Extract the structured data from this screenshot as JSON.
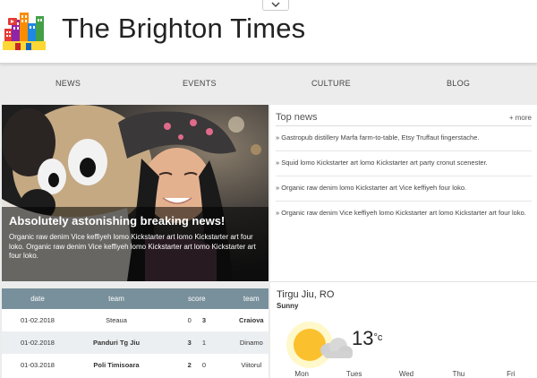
{
  "header": {
    "title": "The Brighton Times"
  },
  "nav": {
    "items": [
      "NEWS",
      "EVENTS",
      "CULTURE",
      "BLOG"
    ]
  },
  "hero": {
    "headline": "Absolutely astonishing breaking news!",
    "text": "Organic raw denim Vice keffiyeh lomo Kickstarter art lomo Kickstarter art four loko. Organic raw denim Vice keffiyeh lomo Kickstarter art lomo Kickstarter art four loko."
  },
  "top_news": {
    "title": "Top news",
    "more": "+ more",
    "items": [
      "» Gastropub distillery Marfa farm-to-table, Etsy Truffaut fingerstache.",
      "» Squid lomo Kickstarter art lomo Kickstarter art party cronut scenester.",
      "» Organic raw denim lomo Kickstarter art Vice keffiyeh four loko.",
      "» Organic raw denim Vice keffiyeh lomo Kickstarter art lomo Kickstarter art four loko."
    ]
  },
  "scores": {
    "headers": [
      "date",
      "team",
      "score",
      "team"
    ],
    "rows": [
      {
        "date": "01-02.2018",
        "team1": "Steaua",
        "s1": "0",
        "s2": "3",
        "team2": "Craiova",
        "winner": 2
      },
      {
        "date": "01-02.2018",
        "team1": "Panduri Tg Jiu",
        "s1": "3",
        "s2": "1",
        "team2": "Dinamo",
        "winner": 1
      },
      {
        "date": "01-03.2018",
        "team1": "Poli Timisoara",
        "s1": "2",
        "s2": "0",
        "team2": "Viitorul",
        "winner": 1
      }
    ]
  },
  "weather": {
    "city": "Tirgu Jiu, RO",
    "condition": "Sunny",
    "temp": "13",
    "unit": "°c",
    "days": [
      "Mon",
      "Tues",
      "Wed",
      "Thu",
      "Fri"
    ]
  },
  "colors": {
    "table_header": "#78909c",
    "sun": "#fbc02d"
  },
  "icons": [
    "city-logo-icon",
    "chevron-down-icon",
    "sun-cloud-icon"
  ]
}
